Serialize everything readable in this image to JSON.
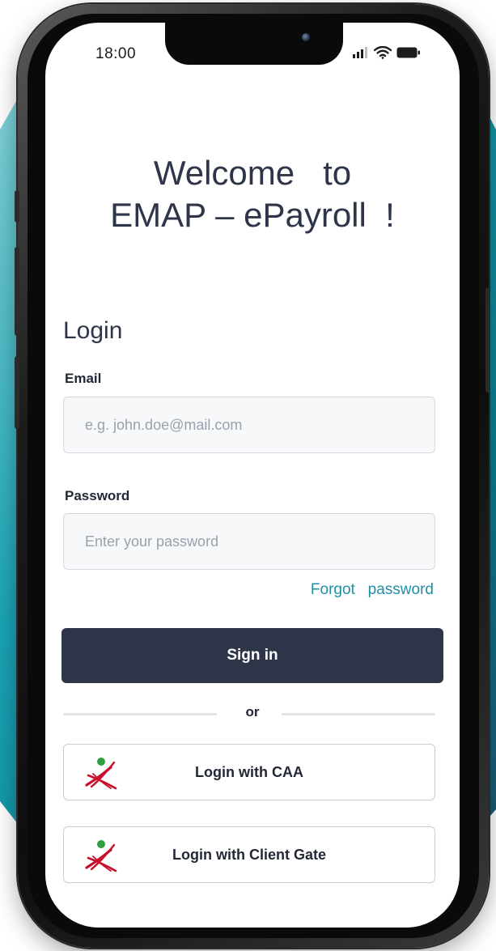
{
  "status_bar": {
    "time": "18:00",
    "icons": [
      "signal-icon",
      "wifi-icon",
      "battery-icon"
    ]
  },
  "welcome": {
    "line1": "Welcome   to",
    "line2": "EMAP – ePayroll  !"
  },
  "login": {
    "heading": "Login",
    "email": {
      "label": "Email",
      "placeholder": "e.g. john.doe@mail.com",
      "value": ""
    },
    "password": {
      "label": "Password",
      "placeholder": "Enter your password",
      "value": ""
    },
    "forgot_password": "Forgot   password",
    "sign_in": "Sign in",
    "or": "or",
    "sso": [
      {
        "label": "Login with CAA",
        "icon": "caa-logo-icon"
      },
      {
        "label": "Login with Client Gate",
        "icon": "client-gate-logo-icon"
      }
    ]
  },
  "colors": {
    "primary": "#2e3548",
    "link": "#1f8fa6",
    "teal_backdrop": "#138ea3",
    "logo_red": "#c8102e",
    "logo_green": "#2e9e3e"
  }
}
